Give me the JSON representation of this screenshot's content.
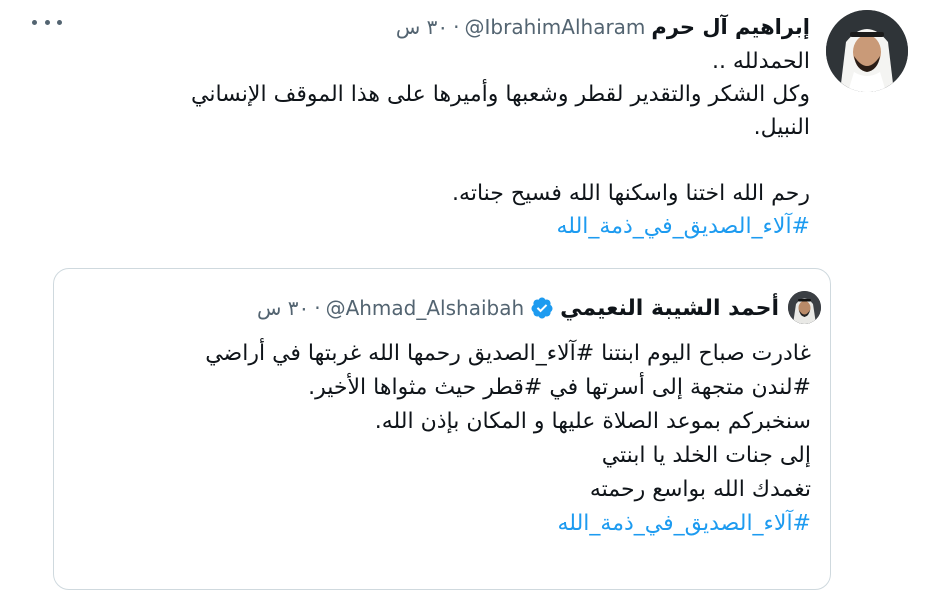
{
  "tweet": {
    "author_name": "إبراهيم آل حرم",
    "handle": "@IbrahimAlharam",
    "separator": "·",
    "time": "٣٠ س",
    "more_icon": "more-horizontal-icon",
    "lines": [
      "الحمدلله ..",
      "وكل الشكر والتقدير لقطر وشعبها وأميرها على هذا الموقف الإنساني",
      "النبيل.",
      "",
      "رحم الله اختنا واسكنها الله فسيح جناته.",
      "#آلاء_الصديق_في_ذمة_الله"
    ]
  },
  "quoted_tweet": {
    "author_name": "أحمد الشيبة النعيمي",
    "verified_icon": "verified-badge-icon",
    "handle": "@Ahmad_Alshaibah",
    "separator": "·",
    "time": "٣٠ س",
    "lines": [
      "غادرت صباح اليوم ابنتنا #آلاء_الصديق رحمها الله غربتها في أراضي",
      "#لندن متجهة إلى أسرتها في #قطر حيث مثواها الأخير.",
      "سنخبركم بموعد الصلاة عليها و المكان بإذن الله.",
      "إلى جنات الخلد يا ابنتي",
      "تغمدك الله بواسع رحمته",
      "#آلاء_الصديق_في_ذمة_الله"
    ]
  },
  "colors": {
    "link": "#1d9bf0",
    "secondary_text": "#536471",
    "border": "#cfd9de",
    "verified": "#1d9bf0"
  }
}
